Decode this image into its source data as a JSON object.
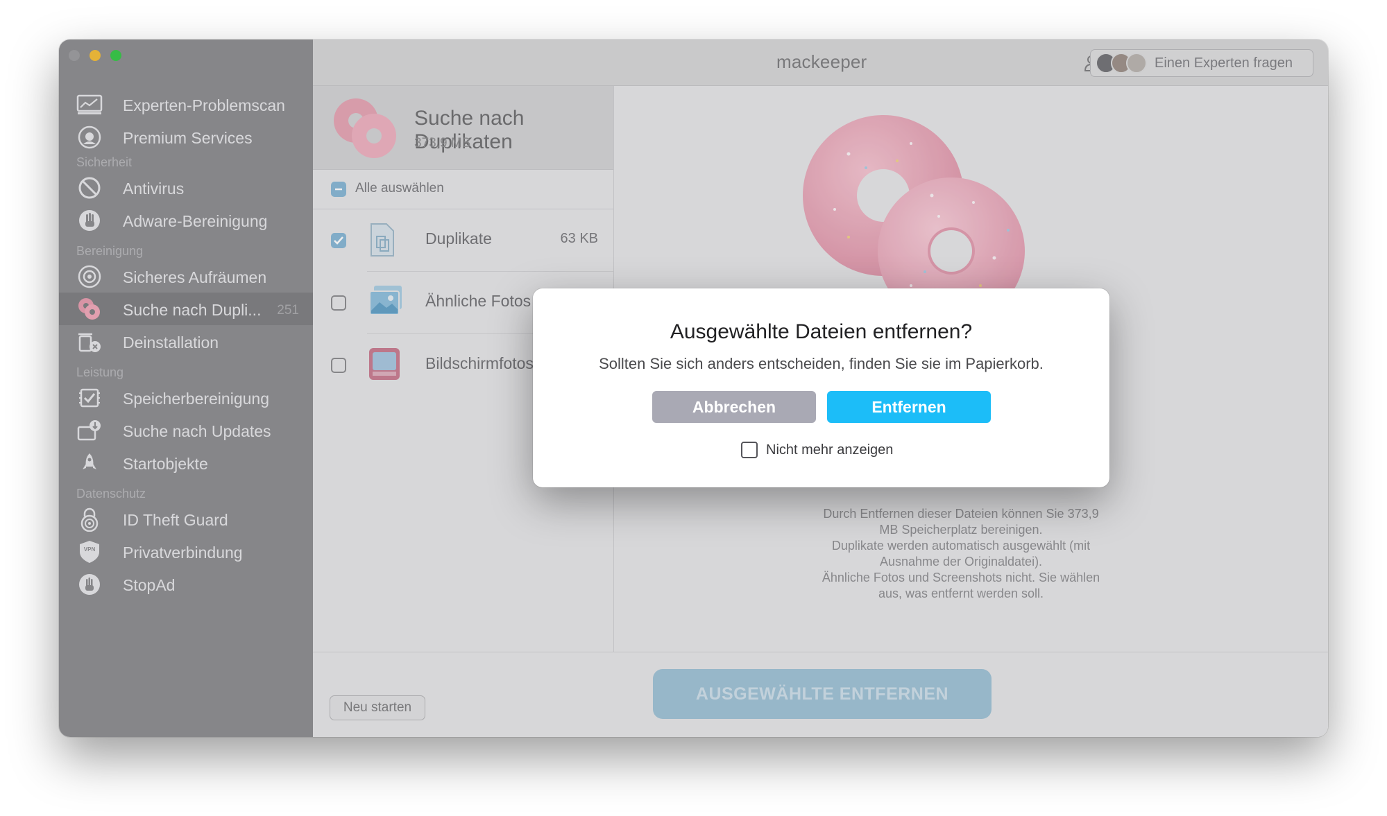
{
  "app": {
    "brand": "mackeeper"
  },
  "sidebar": {
    "items": [
      {
        "label": "Experten-Problemscan",
        "icon": "monitor-chart-icon"
      },
      {
        "label": "Premium Services",
        "icon": "headset-icon"
      },
      {
        "section": "Sicherheit"
      },
      {
        "label": "Antivirus",
        "icon": "shield-slash-icon"
      },
      {
        "label": "Adware-Bereinigung",
        "icon": "hand-stop-icon"
      },
      {
        "section": "Bereinigung"
      },
      {
        "label": "Sicheres Aufräumen",
        "icon": "disk-icon"
      },
      {
        "label": "Suche nach Dupli...",
        "icon": "donut-icon",
        "count": "251",
        "active": true
      },
      {
        "label": "Deinstallation",
        "icon": "trash-x-icon"
      },
      {
        "section": "Leistung"
      },
      {
        "label": "Speicherbereinigung",
        "icon": "memory-check-icon"
      },
      {
        "label": "Suche nach Updates",
        "icon": "update-download-icon"
      },
      {
        "label": "Startobjekte",
        "icon": "rocket-icon"
      },
      {
        "section": "Datenschutz"
      },
      {
        "label": "ID Theft Guard",
        "icon": "fingerprint-lock-icon"
      },
      {
        "label": "Privatverbindung",
        "icon": "vpn-shield-icon"
      },
      {
        "label": "StopAd",
        "icon": "hand-circle-icon"
      }
    ]
  },
  "header": {
    "expert_button": "Einen Experten fragen"
  },
  "list": {
    "title": "Suche nach Duplikaten",
    "size": "373,9 MB",
    "select_all": "Alle auswählen",
    "rows": [
      {
        "name": "Duplikate",
        "size": "63 KB",
        "checked": true
      },
      {
        "name": "Ähnliche Fotos",
        "size": "",
        "checked": false
      },
      {
        "name": "Bildschirmfotos",
        "size": "",
        "checked": false
      }
    ]
  },
  "detail": {
    "description": [
      "Durch Entfernen dieser Dateien können Sie 373,9",
      "MB Speicherplatz bereinigen.",
      "Duplikate werden automatisch ausgewählt (mit",
      "Ausnahme der Originaldatei).",
      "Ähnliche Fotos und Screenshots nicht. Sie wählen",
      "aus, was entfernt werden soll."
    ]
  },
  "bottom": {
    "restart": "Neu starten",
    "remove_selected": "AUSGEWÄHLTE ENTFERNEN"
  },
  "dialog": {
    "title": "Ausgewählte Dateien entfernen?",
    "subtitle": "Sollten Sie sich anders entscheiden, finden Sie sie im Papierkorb.",
    "cancel": "Abbrechen",
    "confirm": "Entfernen",
    "dont_show": "Nicht mehr anzeigen"
  },
  "colors": {
    "accent": "#1cbdf8",
    "sidebar": "#8a8a8c",
    "donut": "#f2a7b8"
  }
}
